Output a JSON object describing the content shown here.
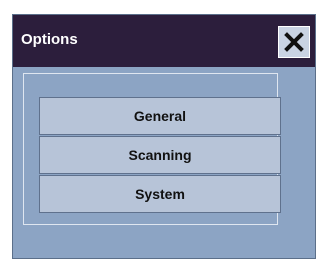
{
  "dialog": {
    "title": "Options",
    "close_icon": "close-icon"
  },
  "options": [
    {
      "label": "General"
    },
    {
      "label": "Scanning"
    },
    {
      "label": "System"
    }
  ],
  "colors": {
    "titlebar": "#2c1e3c",
    "dialog_background": "#8ca4c4",
    "button_background": "#b7c4d8"
  }
}
